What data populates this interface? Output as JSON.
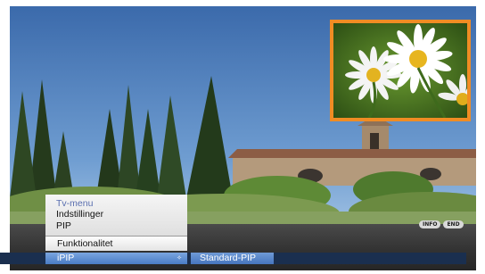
{
  "menu": {
    "title": "Tv-menu",
    "path": [
      "Indstillinger",
      "PIP"
    ],
    "current_section": "Funktionalitet",
    "selected_item": {
      "label": "iPIP",
      "value": "Standard-PIP"
    }
  },
  "buttons": {
    "info": "INFO",
    "end": "END"
  },
  "colors": {
    "pip_border": "#f08c24",
    "menu_title": "#5a6fb0",
    "selection_blue": "#4a7cc4"
  }
}
